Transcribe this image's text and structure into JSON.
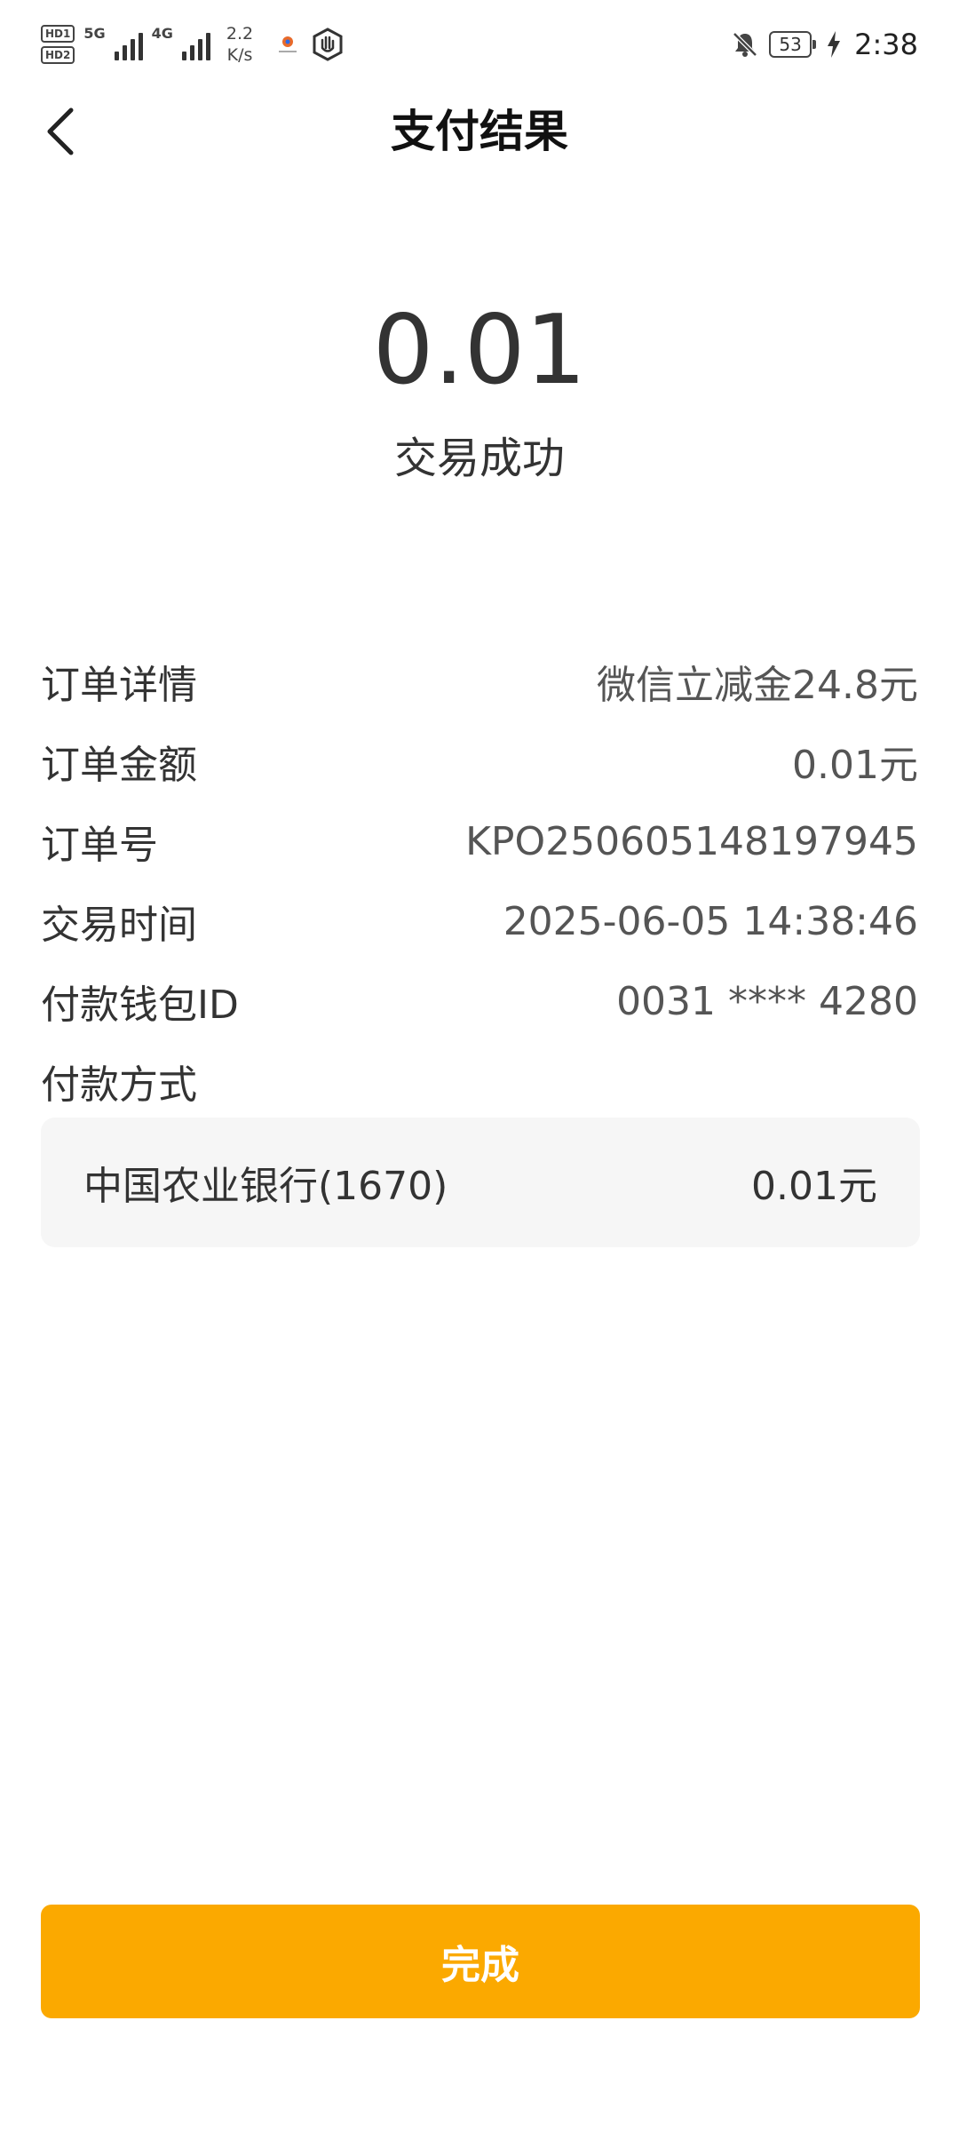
{
  "status_bar": {
    "hd1": "HD1",
    "hd2": "HD2",
    "net_5g": "5G",
    "net_4g": "4G",
    "speed_value": "2.2",
    "speed_unit": "K/s",
    "battery": "53",
    "time": "2:38",
    "icons": [
      "hd-icon",
      "signal-icon",
      "app-notification-icon",
      "hand-app-icon",
      "bell-muted-icon",
      "battery-icon",
      "charging-icon"
    ]
  },
  "nav": {
    "title": "支付结果",
    "back_icon": "chevron-left-icon"
  },
  "result": {
    "amount": "0.01",
    "status": "交易成功"
  },
  "details": [
    {
      "label": "订单详情",
      "value": "微信立减金24.8元"
    },
    {
      "label": "订单金额",
      "value": "0.01元"
    },
    {
      "label": "订单号",
      "value": "KPO250605148197945"
    },
    {
      "label": "交易时间",
      "value": "2025-06-05 14:38:46"
    },
    {
      "label": "付款钱包ID",
      "value": "0031 **** 4280"
    },
    {
      "label": "付款方式",
      "value": ""
    }
  ],
  "payment_method": {
    "bank": "中国农业银行(1670)",
    "amount": "0.01元"
  },
  "done_button": {
    "label": "完成"
  },
  "colors": {
    "accent": "#fba900",
    "card_bg": "#f6f6f6",
    "text_primary": "#333333",
    "text_secondary": "#555555"
  }
}
